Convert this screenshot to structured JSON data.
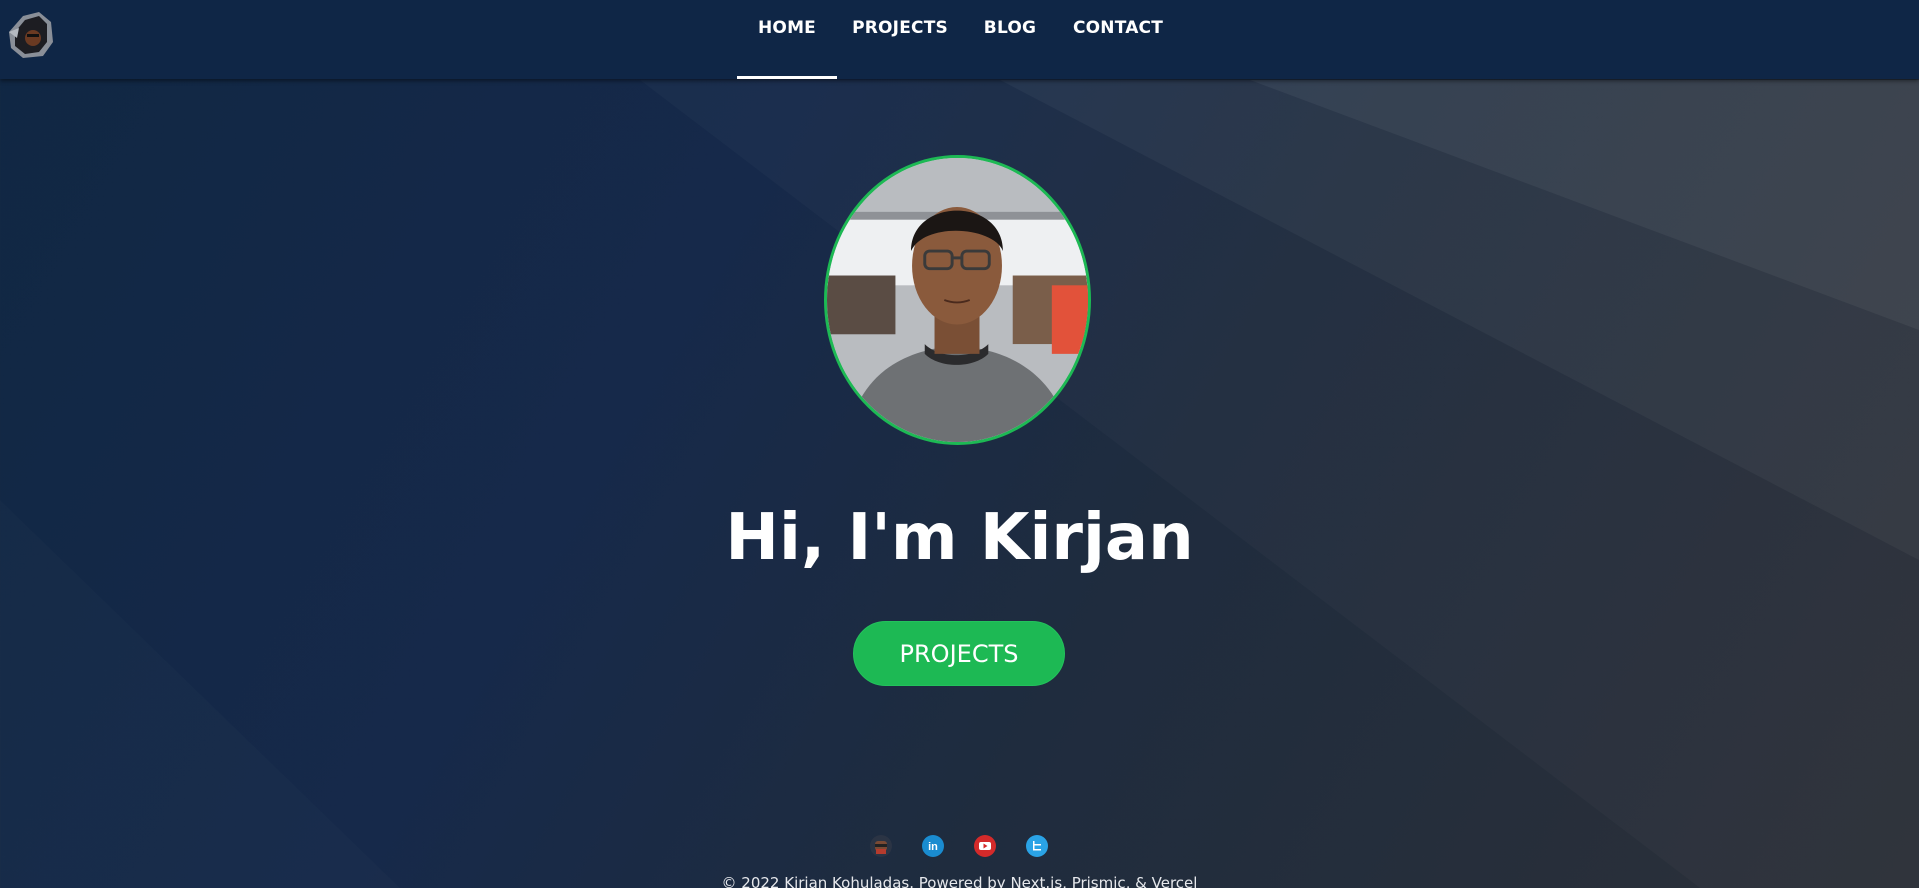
{
  "header": {
    "logo_alt": "site logo",
    "nav": [
      {
        "label": "HOME",
        "active": true
      },
      {
        "label": "PROJECTS",
        "active": false
      },
      {
        "label": "BLOG",
        "active": false
      },
      {
        "label": "CONTACT",
        "active": false
      }
    ]
  },
  "hero": {
    "avatar_alt": "profile photo",
    "title": "Hi, I'm Kirjan",
    "cta_label": "PROJECTS"
  },
  "footer": {
    "socials": [
      {
        "name": "github-icon"
      },
      {
        "name": "linkedin-icon"
      },
      {
        "name": "youtube-icon"
      },
      {
        "name": "twitter-icon"
      }
    ],
    "copyright": "© 2022 Kirjan Kohuladas. Powered by Next.js, Prismic, & Vercel"
  },
  "colors": {
    "header_bg": "#0f2646",
    "accent": "#1db954",
    "text": "#ffffff"
  }
}
